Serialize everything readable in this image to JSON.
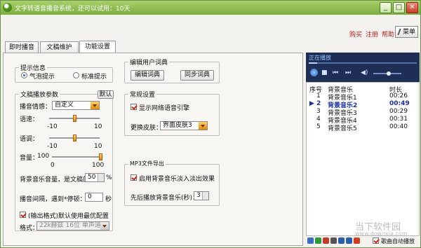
{
  "window": {
    "title": "文字转语音播音系统，还可以试用：10天",
    "min": "_",
    "max": "□",
    "close": "✕"
  },
  "toplinks": {
    "buy": "购买",
    "register": "注册",
    "help": "帮助",
    "menu": "菜单"
  },
  "tabs": [
    {
      "label": "即时播音"
    },
    {
      "label": "文稿维护"
    },
    {
      "label": "功能设置"
    }
  ],
  "prompt_info": {
    "title": "提示信息",
    "bubble": "气泡提示",
    "standard": "标准提示",
    "selected": "bubble"
  },
  "broadcast_params": {
    "title": "文稿播放参数",
    "default_btn": "默认",
    "emotion_label": "播音情感：",
    "emotion_value": "自定义",
    "speed_label": "语速：",
    "speed_min": "-10",
    "speed_max": "10",
    "speed_value": 0,
    "pitch_label": "语调：",
    "pitch_min": "-10",
    "pitch_max": "10",
    "pitch_value": 0,
    "volume_label": "音量：",
    "volume_prefix": "100",
    "volume_min": "0",
    "volume_max": "100",
    "volume_value": 100,
    "bgm_label": "背景音乐音量，是文稿的",
    "bgm_value": "50",
    "bgm_unit": "%",
    "interval_label": "播音间隔，遇到*停顿：",
    "interval_value": "0",
    "interval_unit": "秒",
    "mp3_checked": true,
    "mp3_label": "(输出格式)默认使用最优配置",
    "format_label": "格式：",
    "format_value": "22k赫兹 16位 单声道"
  },
  "dict": {
    "title": "编辑用户词典",
    "edit_btn": "编辑词典",
    "sync_btn": "同步词典"
  },
  "general": {
    "title": "常规设置",
    "engine_checked": true,
    "engine_label": "显示网络语音引擎",
    "skin_label": "更换皮肤：",
    "skin_value": "界面皮肤3"
  },
  "mp3_export": {
    "title": "MP3文件导出",
    "fade_checked": true,
    "fade_label": "启用背景音乐淡入淡出效果",
    "prelude_label": "先后播放背景音乐(秒)：",
    "prelude_value": "3"
  },
  "player": {
    "now_playing": "正在播放",
    "progress": 0.08,
    "volume": 0.55
  },
  "playlist": {
    "headers": {
      "index": "序号",
      "name": "背景音乐",
      "duration": "时长"
    },
    "rows": [
      {
        "index": "1",
        "name": "背景音乐1",
        "duration": "00:26",
        "current": false
      },
      {
        "index": "2",
        "name": "背景音乐2",
        "duration": "00:49",
        "current": true
      },
      {
        "index": "3",
        "name": "背景音乐3",
        "duration": "00:29",
        "current": false
      },
      {
        "index": "4",
        "name": "背景音乐4",
        "duration": "00:31",
        "current": false
      },
      {
        "index": "5",
        "name": "背景音乐5",
        "duration": "00:40",
        "current": false
      }
    ]
  },
  "bottom": {
    "auto_play_checked": true,
    "auto_play_label": "歌曲自动播放"
  },
  "watermark": {
    "cn": "当下软件园",
    "en": "www.downxia.com"
  },
  "colors": {
    "titlebar": "#8fc050",
    "accent_red": "#b0201a",
    "player_bg": "#1f2e55",
    "current_track": "#1a2fa0"
  }
}
